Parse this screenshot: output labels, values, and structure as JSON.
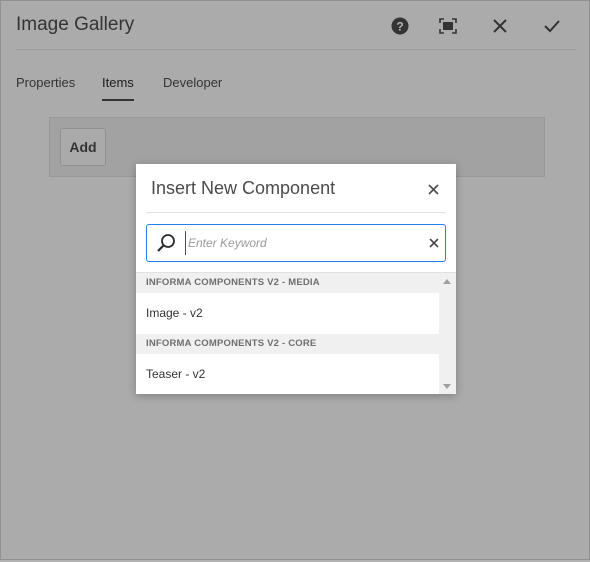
{
  "header": {
    "title": "Image Gallery",
    "icons": [
      "help-icon",
      "fullscreen-icon",
      "close-icon",
      "done-icon"
    ]
  },
  "tabs": [
    {
      "label": "Properties",
      "active": false
    },
    {
      "label": "Items",
      "active": true
    },
    {
      "label": "Developer",
      "active": false
    }
  ],
  "items_panel": {
    "add_label": "Add"
  },
  "dialog": {
    "title": "Insert New Component",
    "search": {
      "placeholder": "Enter Keyword",
      "value": ""
    },
    "groups": [
      {
        "header": "INFORMA COMPONENTS V2 - MEDIA",
        "items": [
          "Image - v2"
        ]
      },
      {
        "header": "INFORMA COMPONENTS V2 - CORE",
        "items": [
          "Teaser - v2"
        ]
      }
    ]
  },
  "colors": {
    "accent": "#2680eb",
    "overlay": "rgba(0,0,0,0.30)"
  }
}
